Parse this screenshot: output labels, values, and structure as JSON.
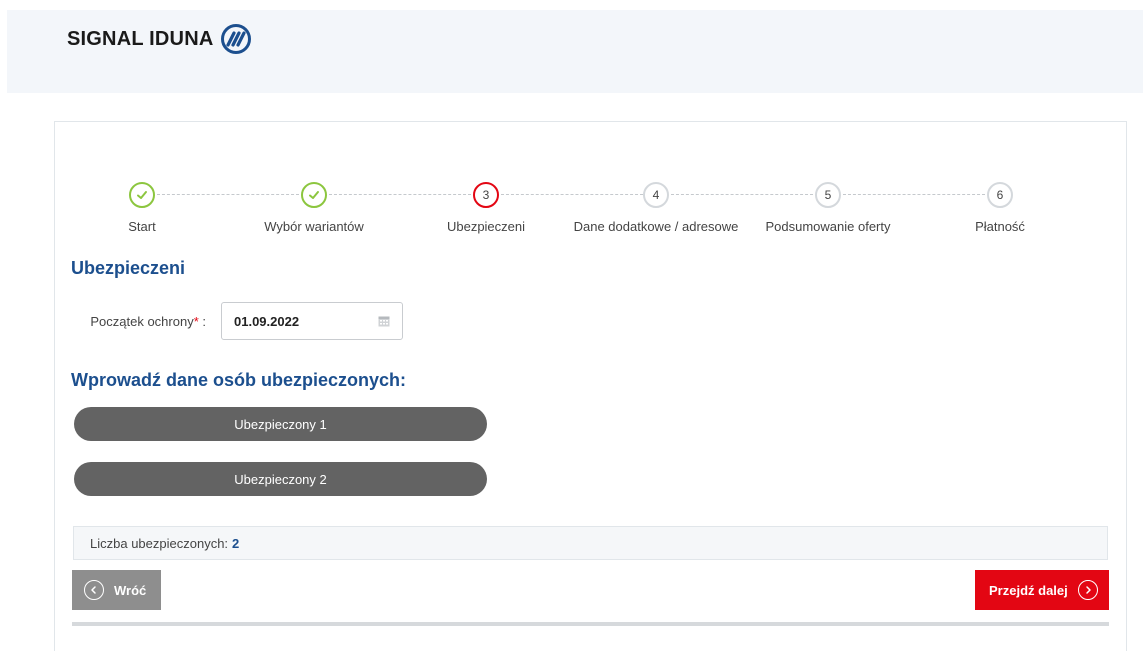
{
  "brand": {
    "name": "SIGNAL IDUNA"
  },
  "stepper": {
    "steps": [
      {
        "label": "Start",
        "number": "1",
        "state": "done"
      },
      {
        "label": "Wybór wariantów",
        "number": "2",
        "state": "done"
      },
      {
        "label": "Ubezpieczeni",
        "number": "3",
        "state": "active"
      },
      {
        "label": "Dane dodatkowe / adresowe",
        "number": "4",
        "state": "pending"
      },
      {
        "label": "Podsumowanie oferty",
        "number": "5",
        "state": "pending"
      },
      {
        "label": "Płatność",
        "number": "6",
        "state": "pending"
      }
    ]
  },
  "form": {
    "section_title": "Ubezpieczeni",
    "start_label": "Początek ochrony",
    "required_mark": "*",
    "label_suffix": " :",
    "start_value": "01.09.2022",
    "insured_title": "Wprowadź dane osób ubezpieczonych:",
    "insured": [
      "Ubezpieczony 1",
      "Ubezpieczony 2"
    ],
    "count_label": "Liczba ubezpieczonych:",
    "count_value": "2"
  },
  "actions": {
    "back": "Wróć",
    "next": "Przejdź dalej"
  },
  "colors": {
    "brand_blue": "#1c4f8e",
    "accent_red": "#e30613",
    "done_green": "#8cc63f",
    "pill_gray": "#636363"
  }
}
